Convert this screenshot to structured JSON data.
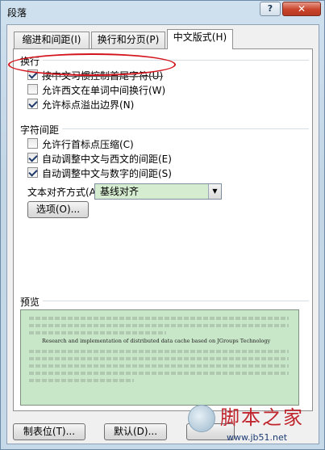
{
  "window": {
    "title": "段落",
    "help_label": "?",
    "close_label": "✕"
  },
  "tabs": [
    {
      "label": "缩进和间距(I)"
    },
    {
      "label": "换行和分页(P)"
    },
    {
      "label": "中文版式(H)",
      "active": true
    }
  ],
  "line_break_section": {
    "title": "换行",
    "options": [
      {
        "label": "按中文习惯控制首尾字符(U)",
        "checked": true
      },
      {
        "label": "允许西文在单词中间换行(W)",
        "checked": false
      },
      {
        "label": "允许标点溢出边界(N)",
        "checked": true
      }
    ]
  },
  "char_spacing_section": {
    "title": "字符间距",
    "options": [
      {
        "label": "允许行首标点压缩(C)",
        "checked": false
      },
      {
        "label": "自动调整中文与西文的间距(E)",
        "checked": true
      },
      {
        "label": "自动调整中文与数字的间距(S)",
        "checked": true
      }
    ],
    "text_alignment_label": "文本对齐方式(A):",
    "text_alignment_value": "基线对齐",
    "options_button": "选项(O)..."
  },
  "preview": {
    "title": "预览",
    "sample_text": "Research and implementation of distributed data cache based on JGroups Technology"
  },
  "footer": {
    "tabs_button": "制表位(T)...",
    "default_button": "默认(D)..."
  },
  "watermark": {
    "title": "脚本之家",
    "url": "www.jb51.net"
  },
  "colors": {
    "highlight_ellipse": "#d4141c",
    "preview_bg": "#c8e6c8",
    "close_button": "#c9432b"
  }
}
